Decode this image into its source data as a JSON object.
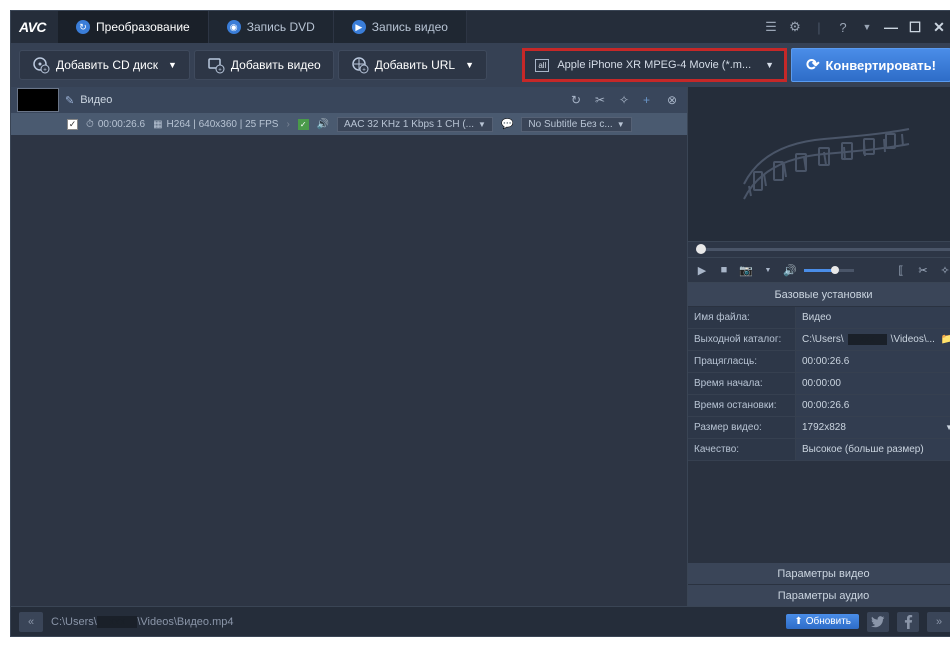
{
  "logo": "AVC",
  "tabs": [
    {
      "label": "Преобразование",
      "active": true
    },
    {
      "label": "Запись DVD",
      "active": false
    },
    {
      "label": "Запись видео",
      "active": false
    }
  ],
  "toolbar": {
    "add_cd": "Добавить CD диск",
    "add_video": "Добавить видео",
    "add_url": "Добавить URL",
    "profile": "Apple iPhone XR MPEG-4 Movie (*.m...",
    "convert": "Конвертировать!"
  },
  "video_item": {
    "title": "Видео",
    "duration": "00:00:26.6",
    "codec_info": "H264 | 640x360 | 25 FPS",
    "audio_info": "AAC 32 KHz 1 Kbps 1 CH (...",
    "subtitle_info": "No Subtitle Без с..."
  },
  "settings": {
    "header": "Базовые установки",
    "rows": {
      "filename": {
        "label": "Имя файла:",
        "value": "Видео"
      },
      "output_dir": {
        "label": "Выходной каталог:",
        "value_prefix": "C:\\Users\\",
        "value_suffix": "\\Videos\\..."
      },
      "duration": {
        "label": "Працягласць:",
        "value": "00:00:26.6"
      },
      "start_time": {
        "label": "Время начала:",
        "value": "00:00:00"
      },
      "stop_time": {
        "label": "Время остановки:",
        "value": "00:00:26.6"
      },
      "video_size": {
        "label": "Размер видео:",
        "value": "1792x828"
      },
      "quality": {
        "label": "Качество:",
        "value": "Высокое (больше размер)"
      }
    },
    "video_params": "Параметры видео",
    "audio_params": "Параметры аудио"
  },
  "statusbar": {
    "path_prefix": "C:\\Users\\",
    "path_suffix": "\\Videos\\Видео.mp4",
    "update": "Обновить"
  }
}
